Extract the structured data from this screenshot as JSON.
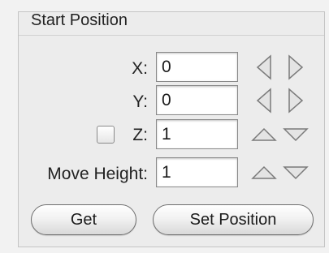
{
  "panel": {
    "title": "Start Position"
  },
  "fields": {
    "x": {
      "label": "X:",
      "value": "0"
    },
    "y": {
      "label": "Y:",
      "value": "0"
    },
    "z": {
      "label": "Z:",
      "value": "1",
      "checked": false
    },
    "move_height": {
      "label": "Move Height:",
      "value": "1"
    }
  },
  "steppers": {
    "x": [
      "arrow-left-icon",
      "arrow-right-icon"
    ],
    "y": [
      "arrow-left-icon",
      "arrow-right-icon"
    ],
    "z": [
      "arrow-up-icon",
      "arrow-down-icon"
    ],
    "move_height": [
      "arrow-up-icon",
      "arrow-down-icon"
    ]
  },
  "buttons": {
    "get": "Get",
    "set_position": "Set Position"
  },
  "colors": {
    "arrow_fill": "#e4e4e4",
    "arrow_stroke": "#7a7a7a"
  }
}
